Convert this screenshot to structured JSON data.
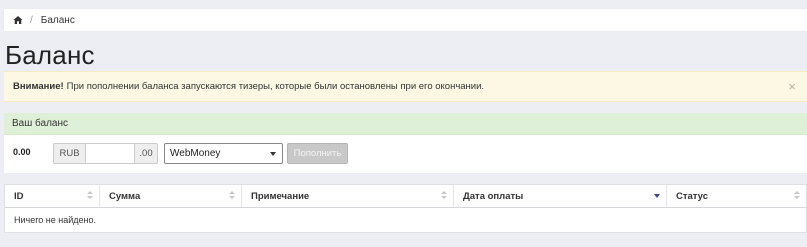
{
  "breadcrumb": {
    "home_icon": "home-icon",
    "separator": "/",
    "current": "Баланс"
  },
  "page": {
    "title": "Баланс"
  },
  "alert": {
    "strong": "Внимание!",
    "text": "При пополнении баланса запускаются тизеры, которые были остановлены при его окончании.",
    "close": "×"
  },
  "balance_panel": {
    "heading": "Ваш баланс",
    "balance": "0.00",
    "currency": "RUB",
    "amount_value": "",
    "cents": ".00",
    "payment_method": "WebMoney",
    "submit_label": "Пополнить"
  },
  "table": {
    "columns": [
      "ID",
      "Сумма",
      "Примечание",
      "Дата оплаты",
      "Статус"
    ],
    "empty_text": "Ничего не найдено."
  },
  "colors": {
    "background": "#edeef4",
    "alert_bg": "#fcf8e3",
    "panel_heading_bg": "#dff0d8",
    "sort_active": "#3a4a9a"
  }
}
